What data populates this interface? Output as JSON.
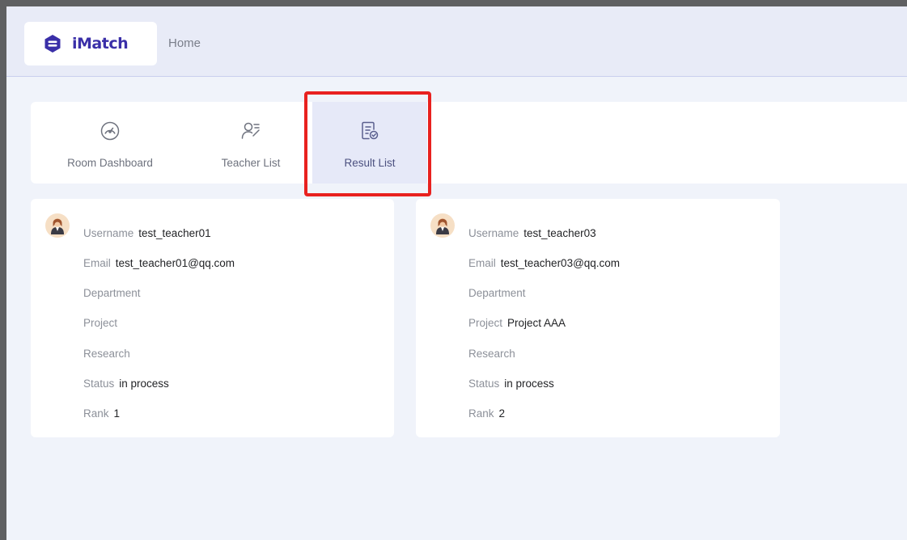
{
  "header": {
    "brand": "iMatch",
    "home_label": "Home",
    "brand_color": "#3a2fa8"
  },
  "nav": {
    "items": [
      {
        "label": "Room Dashboard",
        "icon": "gauge-icon"
      },
      {
        "label": "Teacher List",
        "icon": "users-list-icon"
      },
      {
        "label": "Result List",
        "icon": "result-list-icon",
        "active": true
      }
    ],
    "highlight_color": "#e8211f"
  },
  "cards": [
    {
      "username_label": "Username",
      "username": "test_teacher01",
      "email_label": "Email",
      "email": "test_teacher01@qq.com",
      "department_label": "Department",
      "department": "",
      "project_label": "Project",
      "project": "",
      "research_label": "Research",
      "research": "",
      "status_label": "Status",
      "status": "in process",
      "rank_label": "Rank",
      "rank": "1"
    },
    {
      "username_label": "Username",
      "username": "test_teacher03",
      "email_label": "Email",
      "email": "test_teacher03@qq.com",
      "department_label": "Department",
      "department": "",
      "project_label": "Project",
      "project": "Project AAA",
      "research_label": "Research",
      "research": "",
      "status_label": "Status",
      "status": "in process",
      "rank_label": "Rank",
      "rank": "2"
    }
  ]
}
